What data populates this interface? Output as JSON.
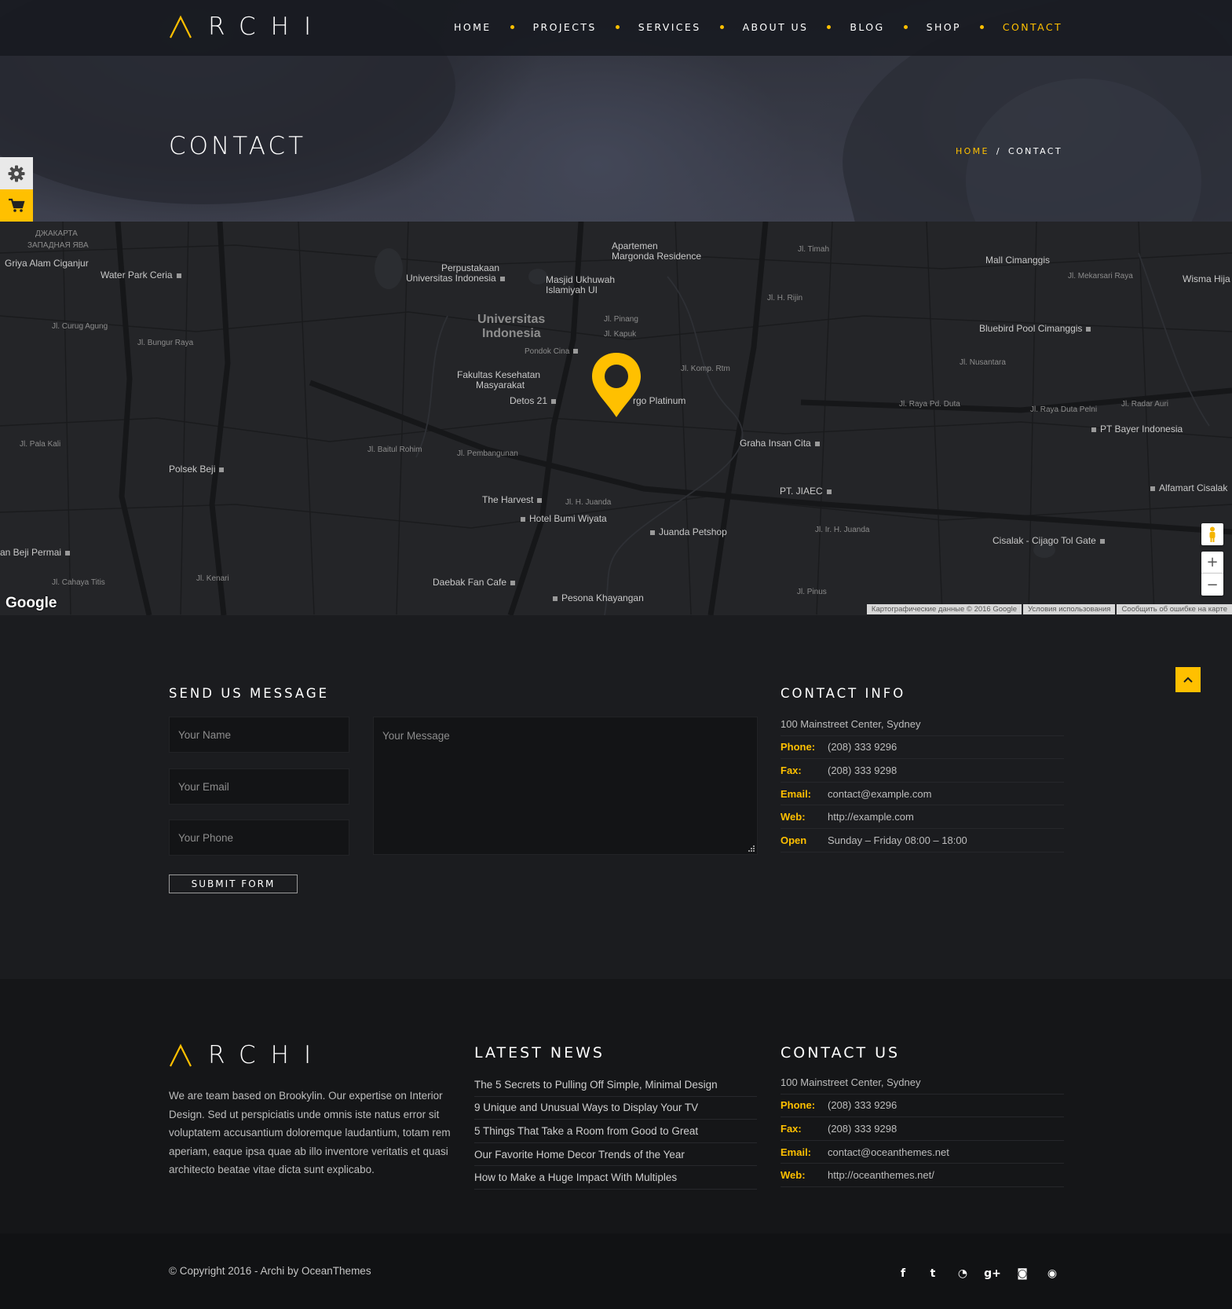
{
  "brand": {
    "name": "RCHI",
    "accent": "#ffc000"
  },
  "nav": {
    "items": [
      {
        "label": "HOME"
      },
      {
        "label": "PROJECTS"
      },
      {
        "label": "SERVICES"
      },
      {
        "label": "ABOUT US"
      },
      {
        "label": "BLOG"
      },
      {
        "label": "SHOP"
      },
      {
        "label": "CONTACT",
        "active": true
      }
    ]
  },
  "hero": {
    "title": "CONTACT",
    "breadcrumb": {
      "home": "HOME",
      "sep": "/",
      "current": "CONTACT"
    }
  },
  "side_tabs": {
    "settings_icon": "gear-icon",
    "cart_icon": "cart-icon"
  },
  "map": {
    "labels": {
      "jakarta": "ДЖАКАРТА",
      "west_java": "ЗАПАДНАЯ ЯВА",
      "griya": "Griya Alam Ciganjur",
      "waterpark": "Water Park Ceria",
      "perpus1": "Perpustakaan",
      "perpus2": "Universitas Indonesia",
      "masjid1": "Masjid Ukhuwah",
      "masjid2": "Islamiyah UI",
      "apart1": "Apartemen",
      "apart2": "Margonda Residence",
      "mall": "Mall Cimanggis",
      "ui1": "Universitas",
      "ui2": "Indonesia",
      "wisma": "Wisma Hija",
      "curug": "Jl. Curug Agung",
      "bungur": "Jl. Bungur Raya",
      "pondok": "Pondok Cina",
      "pinang": "Jl. Pinang",
      "kapuk": "Jl. Kapuk",
      "bluebird": "Bluebird Pool Cimanggis",
      "fk1": "Fakultas Kesehatan",
      "fk2": "Masyarakat",
      "detos": "Detos 21",
      "platinum": "rgo Platinum",
      "komp": "Jl. Komp. Rtm",
      "nusantara": "Jl. Nusantara",
      "raya_pd": "Jl. Raya Pd. Duta",
      "duta_pelni": "Jl. Raya Duta Pelni",
      "radar": "Jl. Radar Auri",
      "ptbayer": "PT Bayer Indonesia",
      "graha": "Graha Insan Cita",
      "pala": "Jl. Pala Kali",
      "baitul": "Jl. Baitul Rohim",
      "pembangunan": "Jl. Pembangunan",
      "polsek": "Polsek Beji",
      "harvest": "The Harvest",
      "ptjiaec": "PT. JIAEC",
      "alfamart": "Alfamart Cisalak",
      "juanda1": "Jl. H. Juanda",
      "hotel": "Hotel Bumi Wiyata",
      "petshop": "Juanda Petshop",
      "juanda2": "Jl. Ir. H. Juanda",
      "cisalak": "Cisalak - Cijago Tol Gate",
      "beji": "an Beji Permai",
      "daebak": "Daebak Fan Cafe",
      "pesona": "Pesona Khayangan",
      "kenari": "Jl. Kenari",
      "cahaya": "Jl. Cahaya Titis",
      "pinus": "Jl. Pinus",
      "rijin": "Jl. H. Rijin",
      "timah": "Jl. Timah",
      "mekarsari": "Jl. Mekarsari Raya"
    },
    "google": "Google",
    "attribution": [
      "Картографические данные © 2016 Google",
      "Условия использования",
      "Сообщить об ошибке на карте"
    ],
    "zoom_in": "+",
    "zoom_out": "−"
  },
  "contact_form": {
    "title": "SEND US MESSAGE",
    "name_placeholder": "Your Name",
    "email_placeholder": "Your Email",
    "phone_placeholder": "Your Phone",
    "message_placeholder": "Your Message",
    "submit_label": "SUBMIT FORM"
  },
  "contact_info": {
    "title": "CONTACT INFO",
    "address": "100 Mainstreet Center, Sydney",
    "rows": [
      {
        "key": "Phone:",
        "value": "(208) 333 9296"
      },
      {
        "key": "Fax:",
        "value": "(208) 333 9298"
      },
      {
        "key": "Email:",
        "value": "contact@example.com"
      },
      {
        "key": "Web:",
        "value": "http://example.com"
      },
      {
        "key": "Open",
        "value": "Sunday – Friday 08:00 – 18:00"
      }
    ]
  },
  "footer": {
    "about": "We are team based on Brookylin. Our expertise on Interior Design. Sed ut perspiciatis unde omnis iste natus error sit voluptatem accusantium doloremque laudantium, totam rem aperiam, eaque ipsa quae ab illo inventore veritatis et quasi architecto beatae vitae dicta sunt explicabo.",
    "news_title": "LATEST NEWS",
    "news": [
      "The 5 Secrets to Pulling Off Simple, Minimal Design",
      "9 Unique and Unusual Ways to Display Your TV",
      "5 Things That Take a Room from Good to Great",
      "Our Favorite Home Decor Trends of the Year",
      "How to Make a Huge Impact With Multiples"
    ],
    "contact_title": "CONTACT US",
    "contact_address": "100 Mainstreet Center, Sydney",
    "contact_rows": [
      {
        "key": "Phone:",
        "value": "(208) 333 9296"
      },
      {
        "key": "Fax:",
        "value": "(208) 333 9298"
      },
      {
        "key": "Email:",
        "value": "contact@oceanthemes.net"
      },
      {
        "key": "Web:",
        "value": "http://oceanthemes.net/"
      }
    ],
    "copyright": "© Copyright 2016 - Archi by OceanThemes",
    "socials": [
      {
        "icon": "facebook-icon",
        "glyph": "f"
      },
      {
        "icon": "twitter-icon",
        "glyph": "t"
      },
      {
        "icon": "rss-icon",
        "glyph": "◔"
      },
      {
        "icon": "google-plus-icon",
        "glyph": "g+"
      },
      {
        "icon": "instagram-icon",
        "glyph": "◙"
      },
      {
        "icon": "github-icon",
        "glyph": "◉"
      }
    ]
  }
}
